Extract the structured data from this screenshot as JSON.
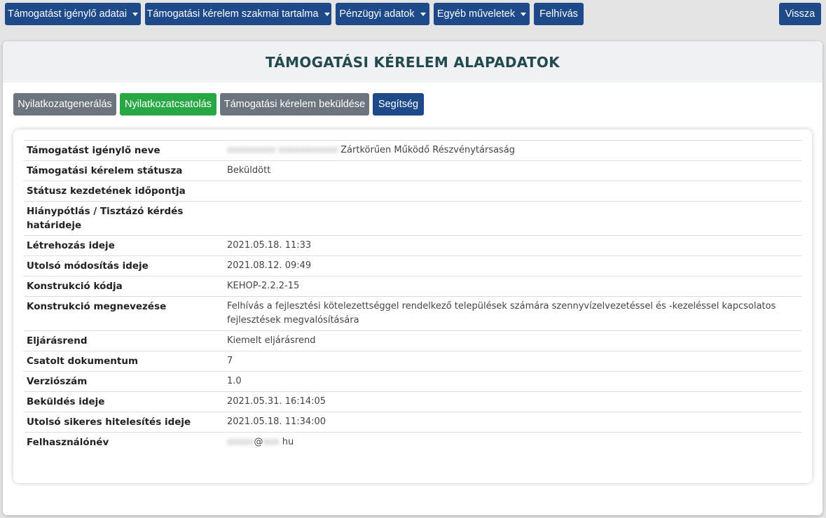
{
  "topnav": {
    "applicant_data": "Támogatást igénylő adatai",
    "professional_content": "Támogatási kérelem szakmai tartalma",
    "financial_data": "Pénzügyi adatok",
    "other_operations": "Egyéb műveletek",
    "call": "Felhívás",
    "back": "Vissza"
  },
  "panel": {
    "title": "TÁMOGATÁSI KÉRELEM ALAPADATOK"
  },
  "actions": {
    "generate_declaration": "Nyilatkozatgenerálás",
    "attach_declaration": "Nyilatkozatcsatolás",
    "submit_application": "Támogatási kérelem beküldése",
    "help": "Segítség"
  },
  "details": {
    "rows": [
      {
        "label": "Támogatást igénylő neve",
        "value_hidden": "xxxxxxxxx xxxxxxxxxxx",
        "value": "Zártkörűen Működő Részvénytársaság"
      },
      {
        "label": "Támogatási kérelem státusza",
        "value": "Beküldött"
      },
      {
        "label": "Státusz kezdetének időpontja",
        "value": ""
      },
      {
        "label": "Hiánypótlás / Tisztázó kérdés határideje",
        "value": ""
      },
      {
        "label": "Létrehozás ideje",
        "value": "2021.05.18. 11:33"
      },
      {
        "label": "Utolsó módosítás ideje",
        "value": "2021.08.12. 09:49"
      },
      {
        "label": "Konstrukció kódja",
        "value": "KEHOP-2.2.2-15"
      },
      {
        "label": "Konstrukció megnevezése",
        "value": "Felhívás a fejlesztési kötelezettséggel rendelkező települések számára szennyvízelvezetéssel és -kezeléssel kapcsolatos fejlesztések megvalósítására"
      },
      {
        "label": "Eljárásrend",
        "value": "Kiemelt eljárásrend"
      },
      {
        "label": "Csatolt dokumentum",
        "value": "7"
      },
      {
        "label": "Verziószám",
        "value": "1.0"
      },
      {
        "label": "Beküldés ideje",
        "value": "2021.05.31. 16:14:05"
      },
      {
        "label": "Utolsó sikeres hitelesítés ideje",
        "value": "2021.05.18. 11:34:00"
      },
      {
        "label": "Felhasználónév",
        "value_hidden": "xxxxx",
        "value": "@",
        "value_hidden2": "xxx",
        "value_suffix": "hu"
      }
    ]
  }
}
